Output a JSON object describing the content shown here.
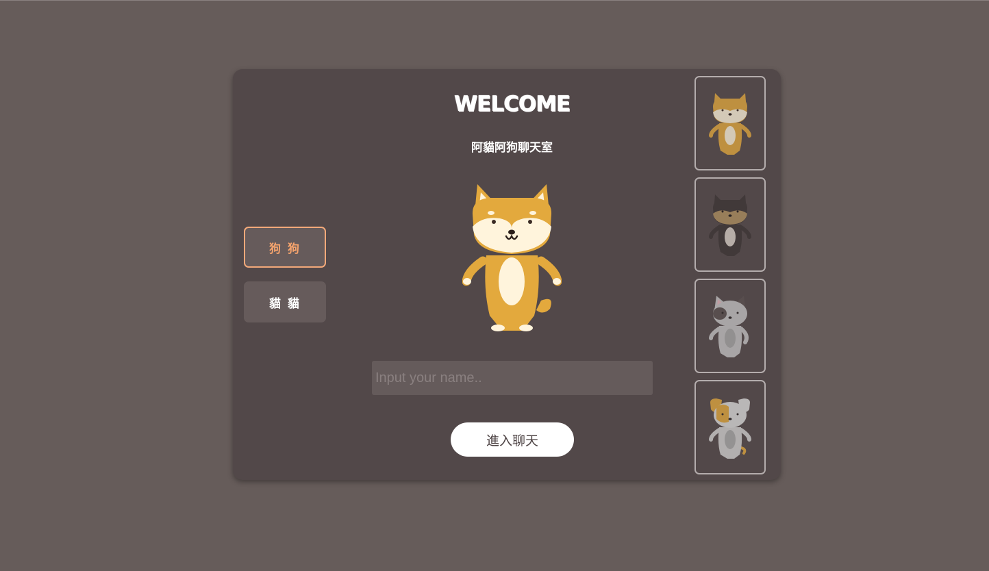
{
  "welcome": {
    "title": "WELCOME",
    "subtitle": "阿貓阿狗聊天室",
    "name_placeholder": "Input your name..",
    "enter_label": "進入聊天"
  },
  "type_buttons": {
    "dog_label": "狗 狗",
    "cat_label": "貓 貓"
  },
  "avatars": [
    {
      "name": "shiba-dog",
      "main": "#e3a93d"
    },
    {
      "name": "husky-dog",
      "main": "#4c4443"
    },
    {
      "name": "gray-cat",
      "main": "#bdbdbd"
    },
    {
      "name": "patched-dog",
      "main": "#c8c4c4"
    }
  ],
  "colors": {
    "page_bg": "#665c5a",
    "card_bg": "#524849",
    "accent": "#f6a46d",
    "selected_avatar": "#e3a93d"
  }
}
